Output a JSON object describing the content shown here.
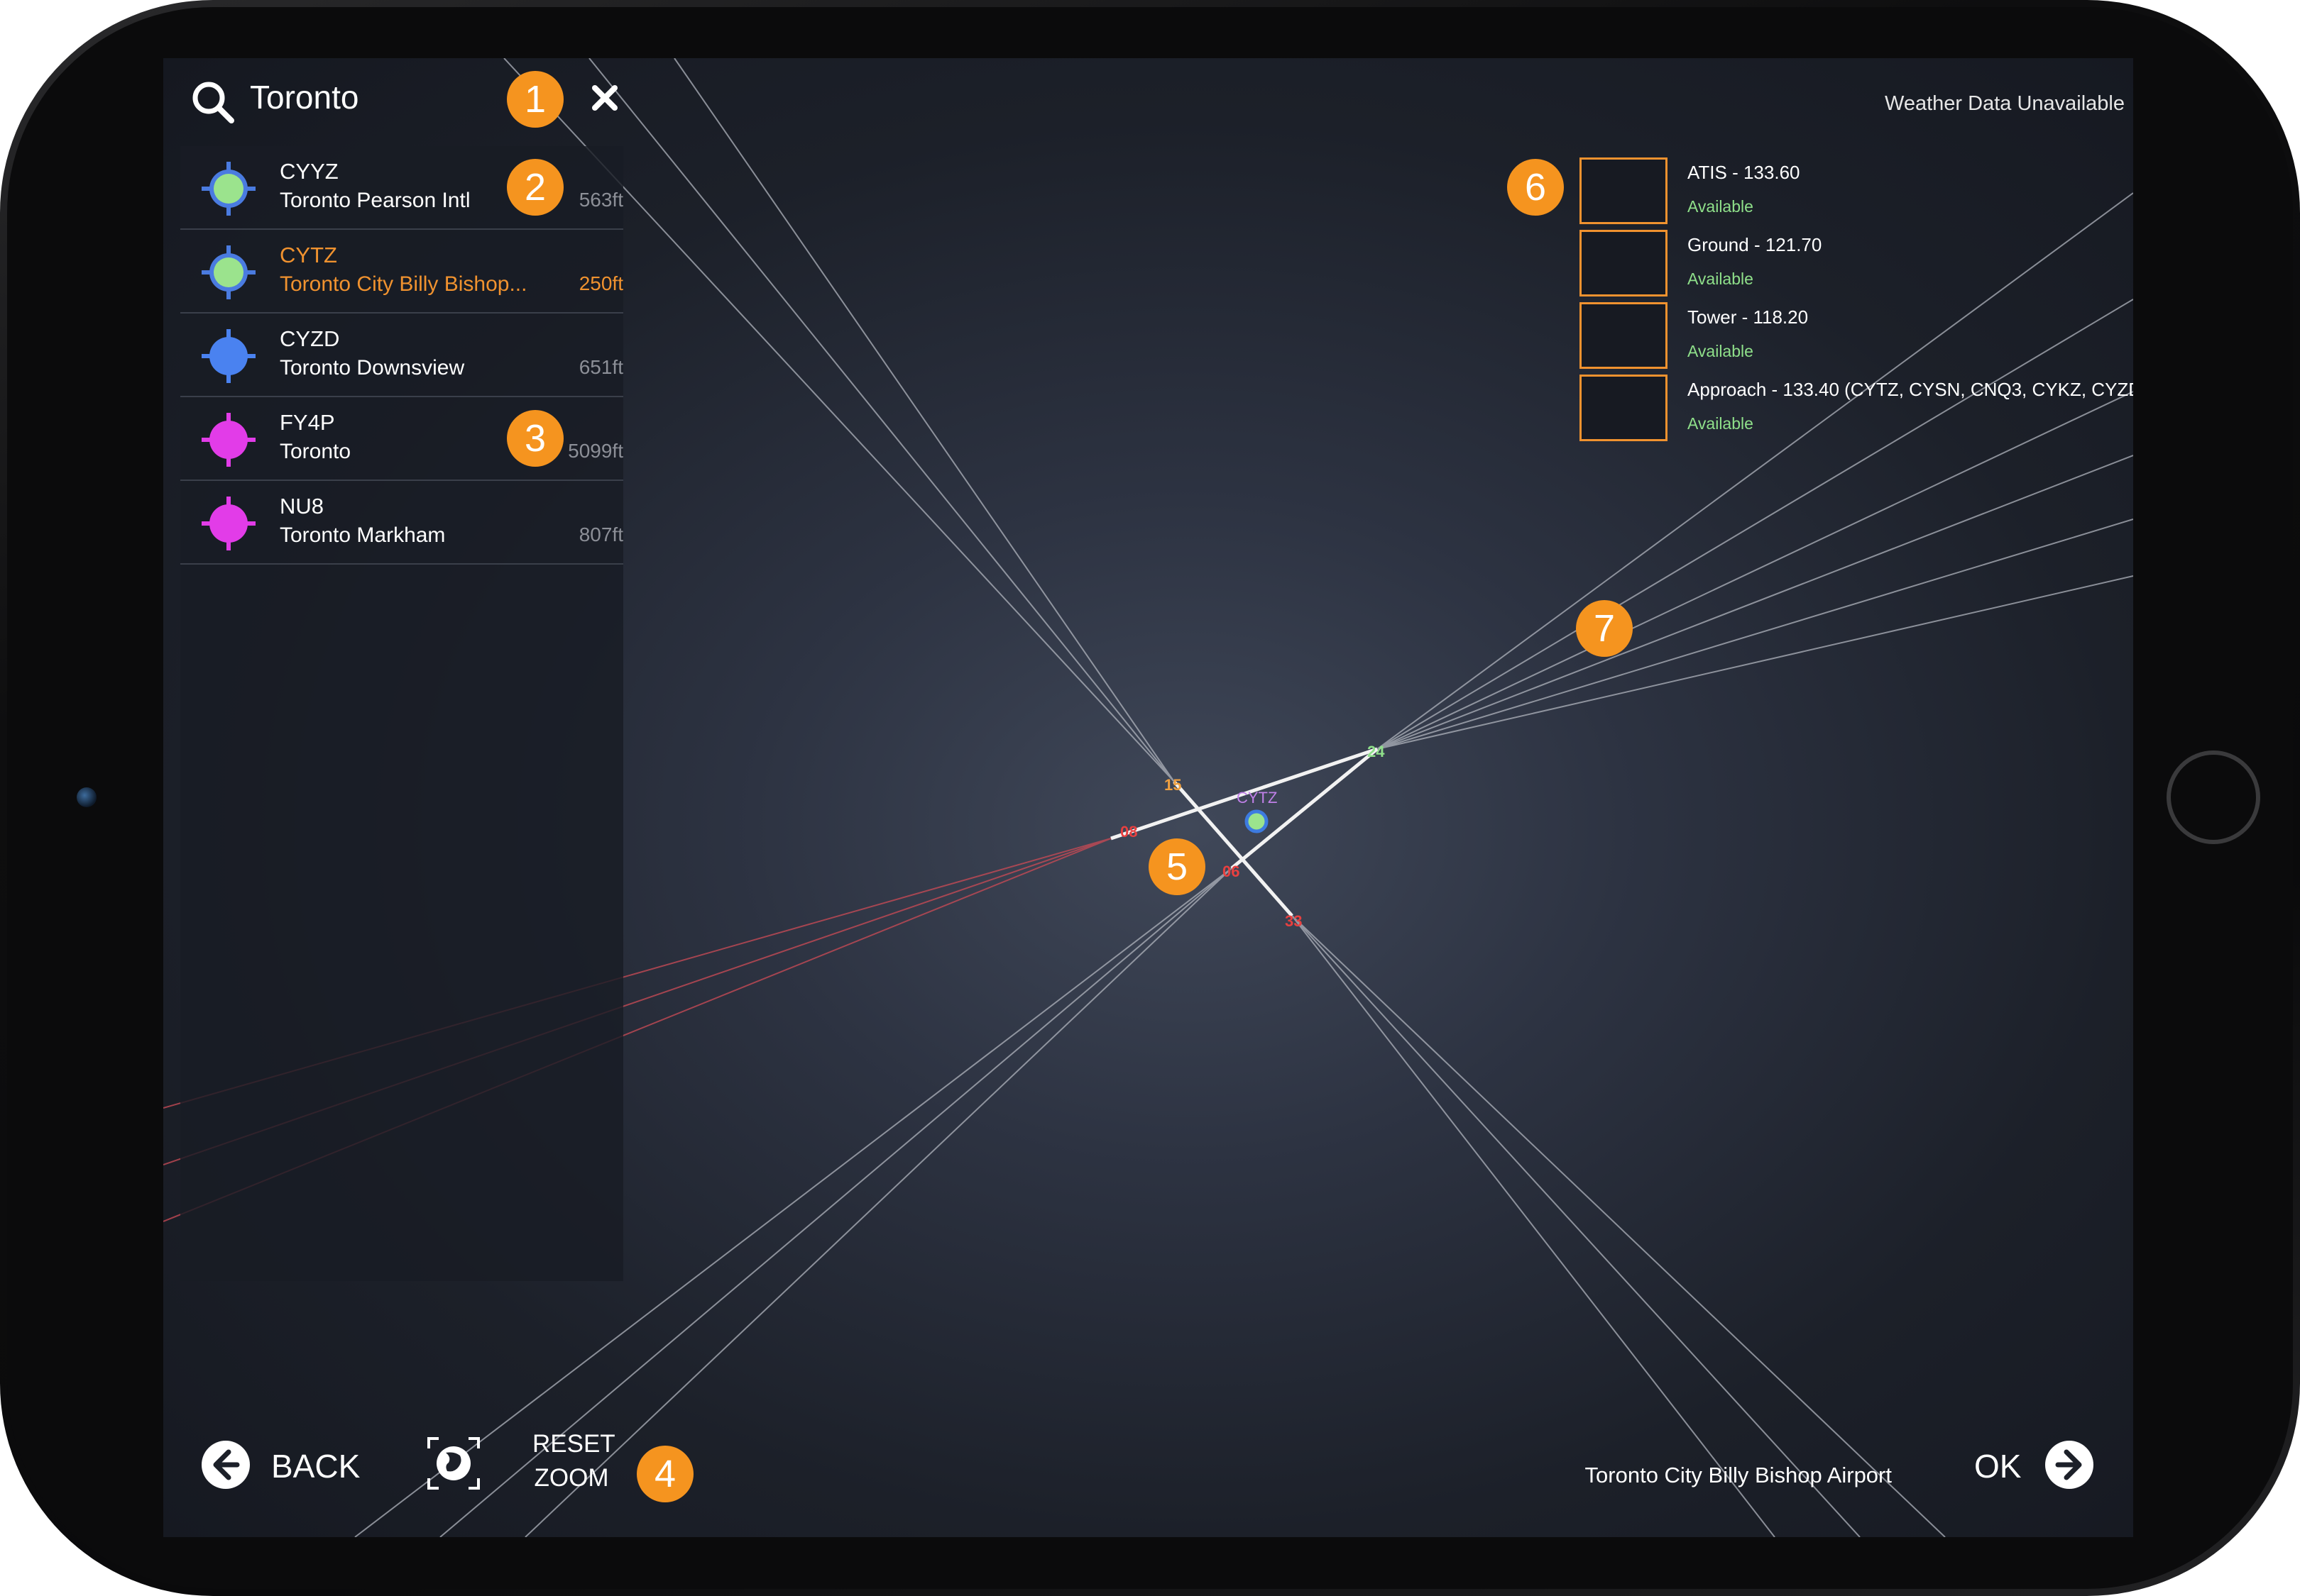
{
  "search": {
    "query": "Toronto"
  },
  "results": [
    {
      "code": "CYYZ",
      "name": "Toronto Pearson Intl",
      "elevation": "563ft",
      "marker_color": "#9be38d",
      "ring": true,
      "selected": false
    },
    {
      "code": "CYTZ",
      "name": "Toronto City Billy Bishop...",
      "elevation": "250ft",
      "marker_color": "#9be38d",
      "ring": true,
      "selected": true
    },
    {
      "code": "CYZD",
      "name": "Toronto Downsview",
      "elevation": "651ft",
      "marker_color": "#4a82f0",
      "ring": false,
      "selected": false
    },
    {
      "code": "FY4P",
      "name": "Toronto",
      "elevation": "5099ft",
      "marker_color": "#e23ce8",
      "ring": false,
      "selected": false
    },
    {
      "code": "NU8",
      "name": "Toronto Markham",
      "elevation": "807ft",
      "marker_color": "#e23ce8",
      "ring": false,
      "selected": false
    }
  ],
  "weather": {
    "status": "Weather Data Unavailable"
  },
  "frequencies": [
    {
      "name": "ATIS - 133.60",
      "status": "Available"
    },
    {
      "name": "Ground - 121.70",
      "status": "Available"
    },
    {
      "name": "Tower - 118.20",
      "status": "Available"
    },
    {
      "name": "Approach - 133.40 (CYTZ, CYSN, CNQ3, CYKZ, CYZD",
      "status": "Available"
    }
  ],
  "map": {
    "airport_label": "CYTZ",
    "runway_labels": [
      {
        "text": "15",
        "color": "#f0a040"
      },
      {
        "text": "24",
        "color": "#8fe08a"
      },
      {
        "text": "08",
        "color": "#e84040"
      },
      {
        "text": "06",
        "color": "#e84040"
      },
      {
        "text": "33",
        "color": "#e84040"
      }
    ]
  },
  "badges": [
    "1",
    "2",
    "3",
    "4",
    "5",
    "6",
    "7"
  ],
  "footer": {
    "back_label": "BACK",
    "reset_zoom_label_line1": "RESET",
    "reset_zoom_label_line2": "ZOOM",
    "airport_name": "Toronto City Billy Bishop Airport",
    "ok_label": "OK"
  },
  "colors": {
    "accent": "#f5941f",
    "available": "#8fe08a",
    "approach_line": "#b0b4bd",
    "alert_line": "#c44a55"
  }
}
